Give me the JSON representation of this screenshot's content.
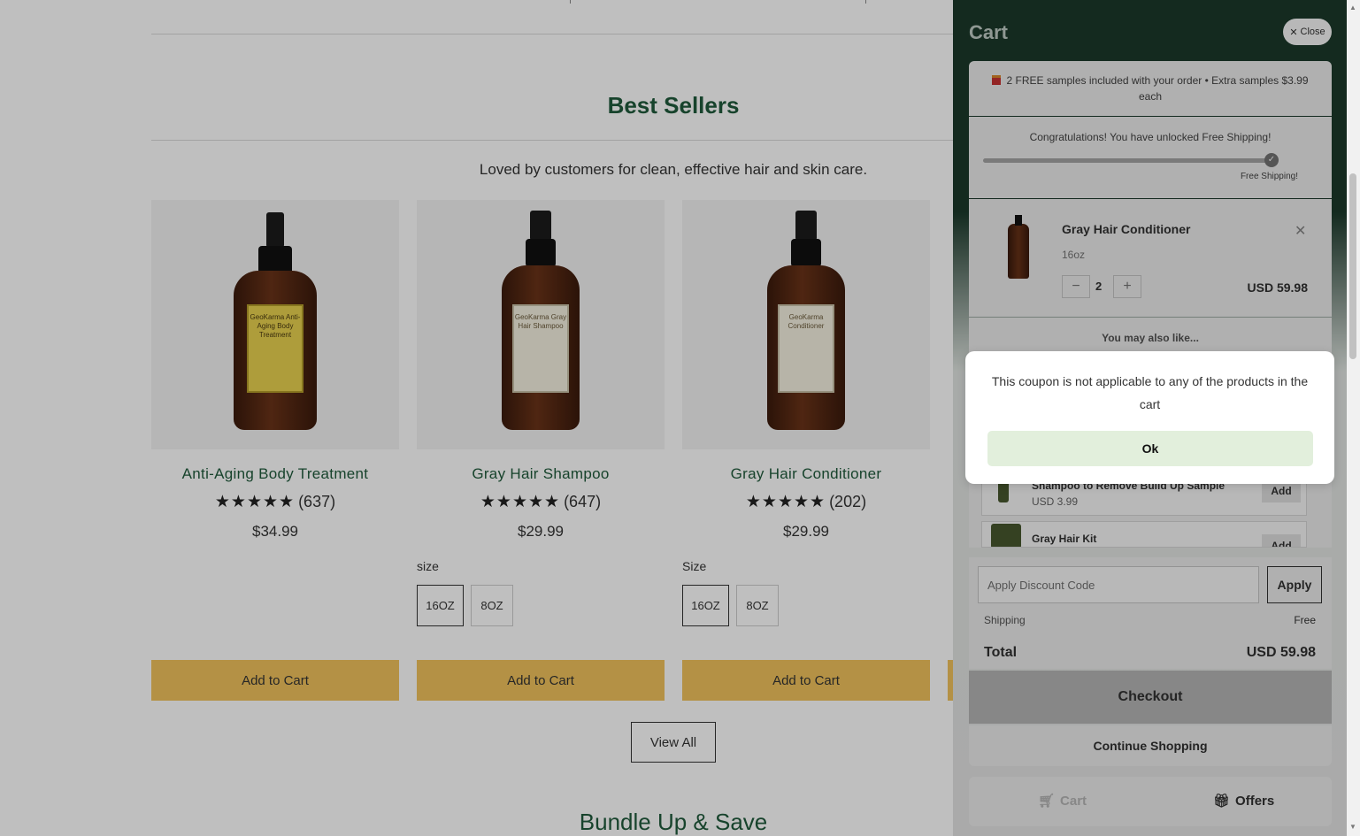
{
  "page": {
    "best_sellers_title": "Best Sellers",
    "best_sellers_subtitle": "Loved by customers for clean, effective hair and skin care.",
    "view_all_label": "View All",
    "bundle_title": "Bundle Up & Save",
    "products": [
      {
        "name": "Anti-Aging Body Treatment",
        "stars": "★★★★★",
        "review_count": "(637)",
        "price": "$34.99",
        "add_label": "Add to Cart",
        "label_text": "GeoKarma Anti-Aging Body Treatment"
      },
      {
        "name": "Gray Hair Shampoo",
        "stars": "★★★★★",
        "review_count": "(647)",
        "price": "$29.99",
        "size_label": "size",
        "sizes": [
          "16OZ",
          "8OZ"
        ],
        "add_label": "Add to Cart",
        "label_text": "GeoKarma Gray Hair Shampoo"
      },
      {
        "name": "Gray Hair Conditioner",
        "stars": "★★★★★",
        "review_count": "(202)",
        "price": "$29.99",
        "size_label": "Size",
        "sizes": [
          "16OZ",
          "8OZ"
        ],
        "add_label": "Add to Cart",
        "label_text": "GeoKarma Conditioner"
      }
    ]
  },
  "cart": {
    "title": "Cart",
    "close_label": "Close",
    "samples_text": "2 FREE samples included with your order • Extra samples $3.99 each",
    "shipping_message": "Congratulations! You have unlocked Free Shipping!",
    "shipping_goal_label": "Free Shipping!",
    "shipping_progress": 1.0,
    "item": {
      "name": "Gray Hair Conditioner",
      "variant": "16oz",
      "quantity": "2",
      "price": "USD 59.98"
    },
    "upsell_title": "You may also like...",
    "upsell_items": [
      {
        "name": "Shampoo to Remove Build Up Sample",
        "price": "USD 3.99",
        "add_label": "Add"
      },
      {
        "name": "Gray Hair Kit",
        "price": "",
        "add_label": "Add"
      }
    ],
    "discount_placeholder": "Apply Discount Code",
    "apply_label": "Apply",
    "shipping_label": "Shipping",
    "shipping_value": "Free",
    "total_label": "Total",
    "total_value": "USD 59.98",
    "checkout_label": "Checkout",
    "continue_label": "Continue Shopping",
    "tabs": {
      "cart": "Cart",
      "offers": "Offers"
    }
  },
  "modal": {
    "message": "This coupon is not applicable to any of the products in the cart",
    "ok_label": "Ok"
  },
  "colors": {
    "brand_green": "#1f5a3b",
    "add_to_cart": "#f0c25c",
    "drawer_header": "#1c3b2c",
    "ok_button": "#e2efdc"
  }
}
